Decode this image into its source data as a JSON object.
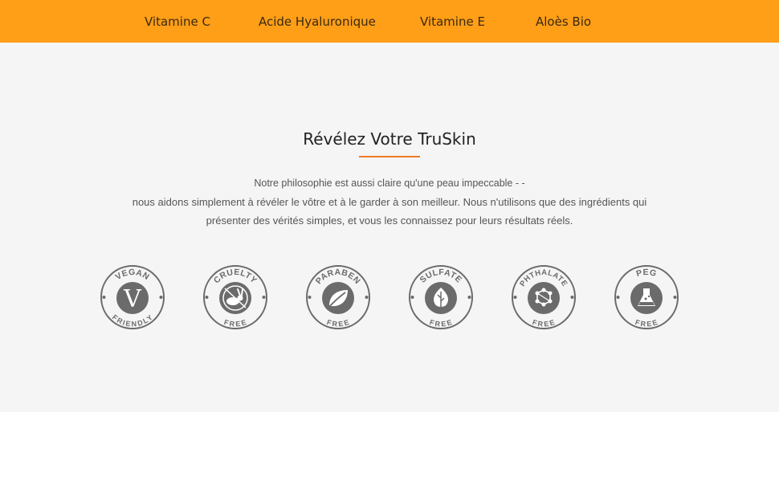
{
  "nav": {
    "items": [
      {
        "label": "Vitamine C"
      },
      {
        "label": "Acide Hyaluronique"
      },
      {
        "label": "Vitamine E"
      },
      {
        "label": "Aloès Bio"
      }
    ]
  },
  "main": {
    "title": "Révélez Votre TruSkin",
    "paragraph_lines": [
      "Notre philosophie est aussi claire qu'une peau impeccable - -",
      "nous aidons simplement à révéler le vôtre et à le garder à son meilleur. Nous n'utilisons que des ingrédients qui",
      "présenter des vérités simples, et vous les connaissez pour leurs résultats réels."
    ],
    "accent_color": "#f07a22"
  },
  "badges": [
    {
      "top": "VEGAN",
      "bottom": "FRIENDLY",
      "icon": "letter-v-icon"
    },
    {
      "top": "CRUELTY",
      "bottom": "FREE",
      "icon": "rabbit-icon"
    },
    {
      "top": "PARABEN",
      "bottom": "FREE",
      "icon": "leaf-icon"
    },
    {
      "top": "SULFATE",
      "bottom": "FREE",
      "icon": "leaf-drop-icon"
    },
    {
      "top": "PHTHALATE",
      "bottom": "FREE",
      "icon": "molecule-icon"
    },
    {
      "top": "PEG",
      "bottom": "FREE",
      "icon": "flask-icon"
    }
  ],
  "colors": {
    "nav_bg": "#ff9e17",
    "section_bg": "#f5f5f5",
    "badge_gray": "#6b6b6b"
  }
}
